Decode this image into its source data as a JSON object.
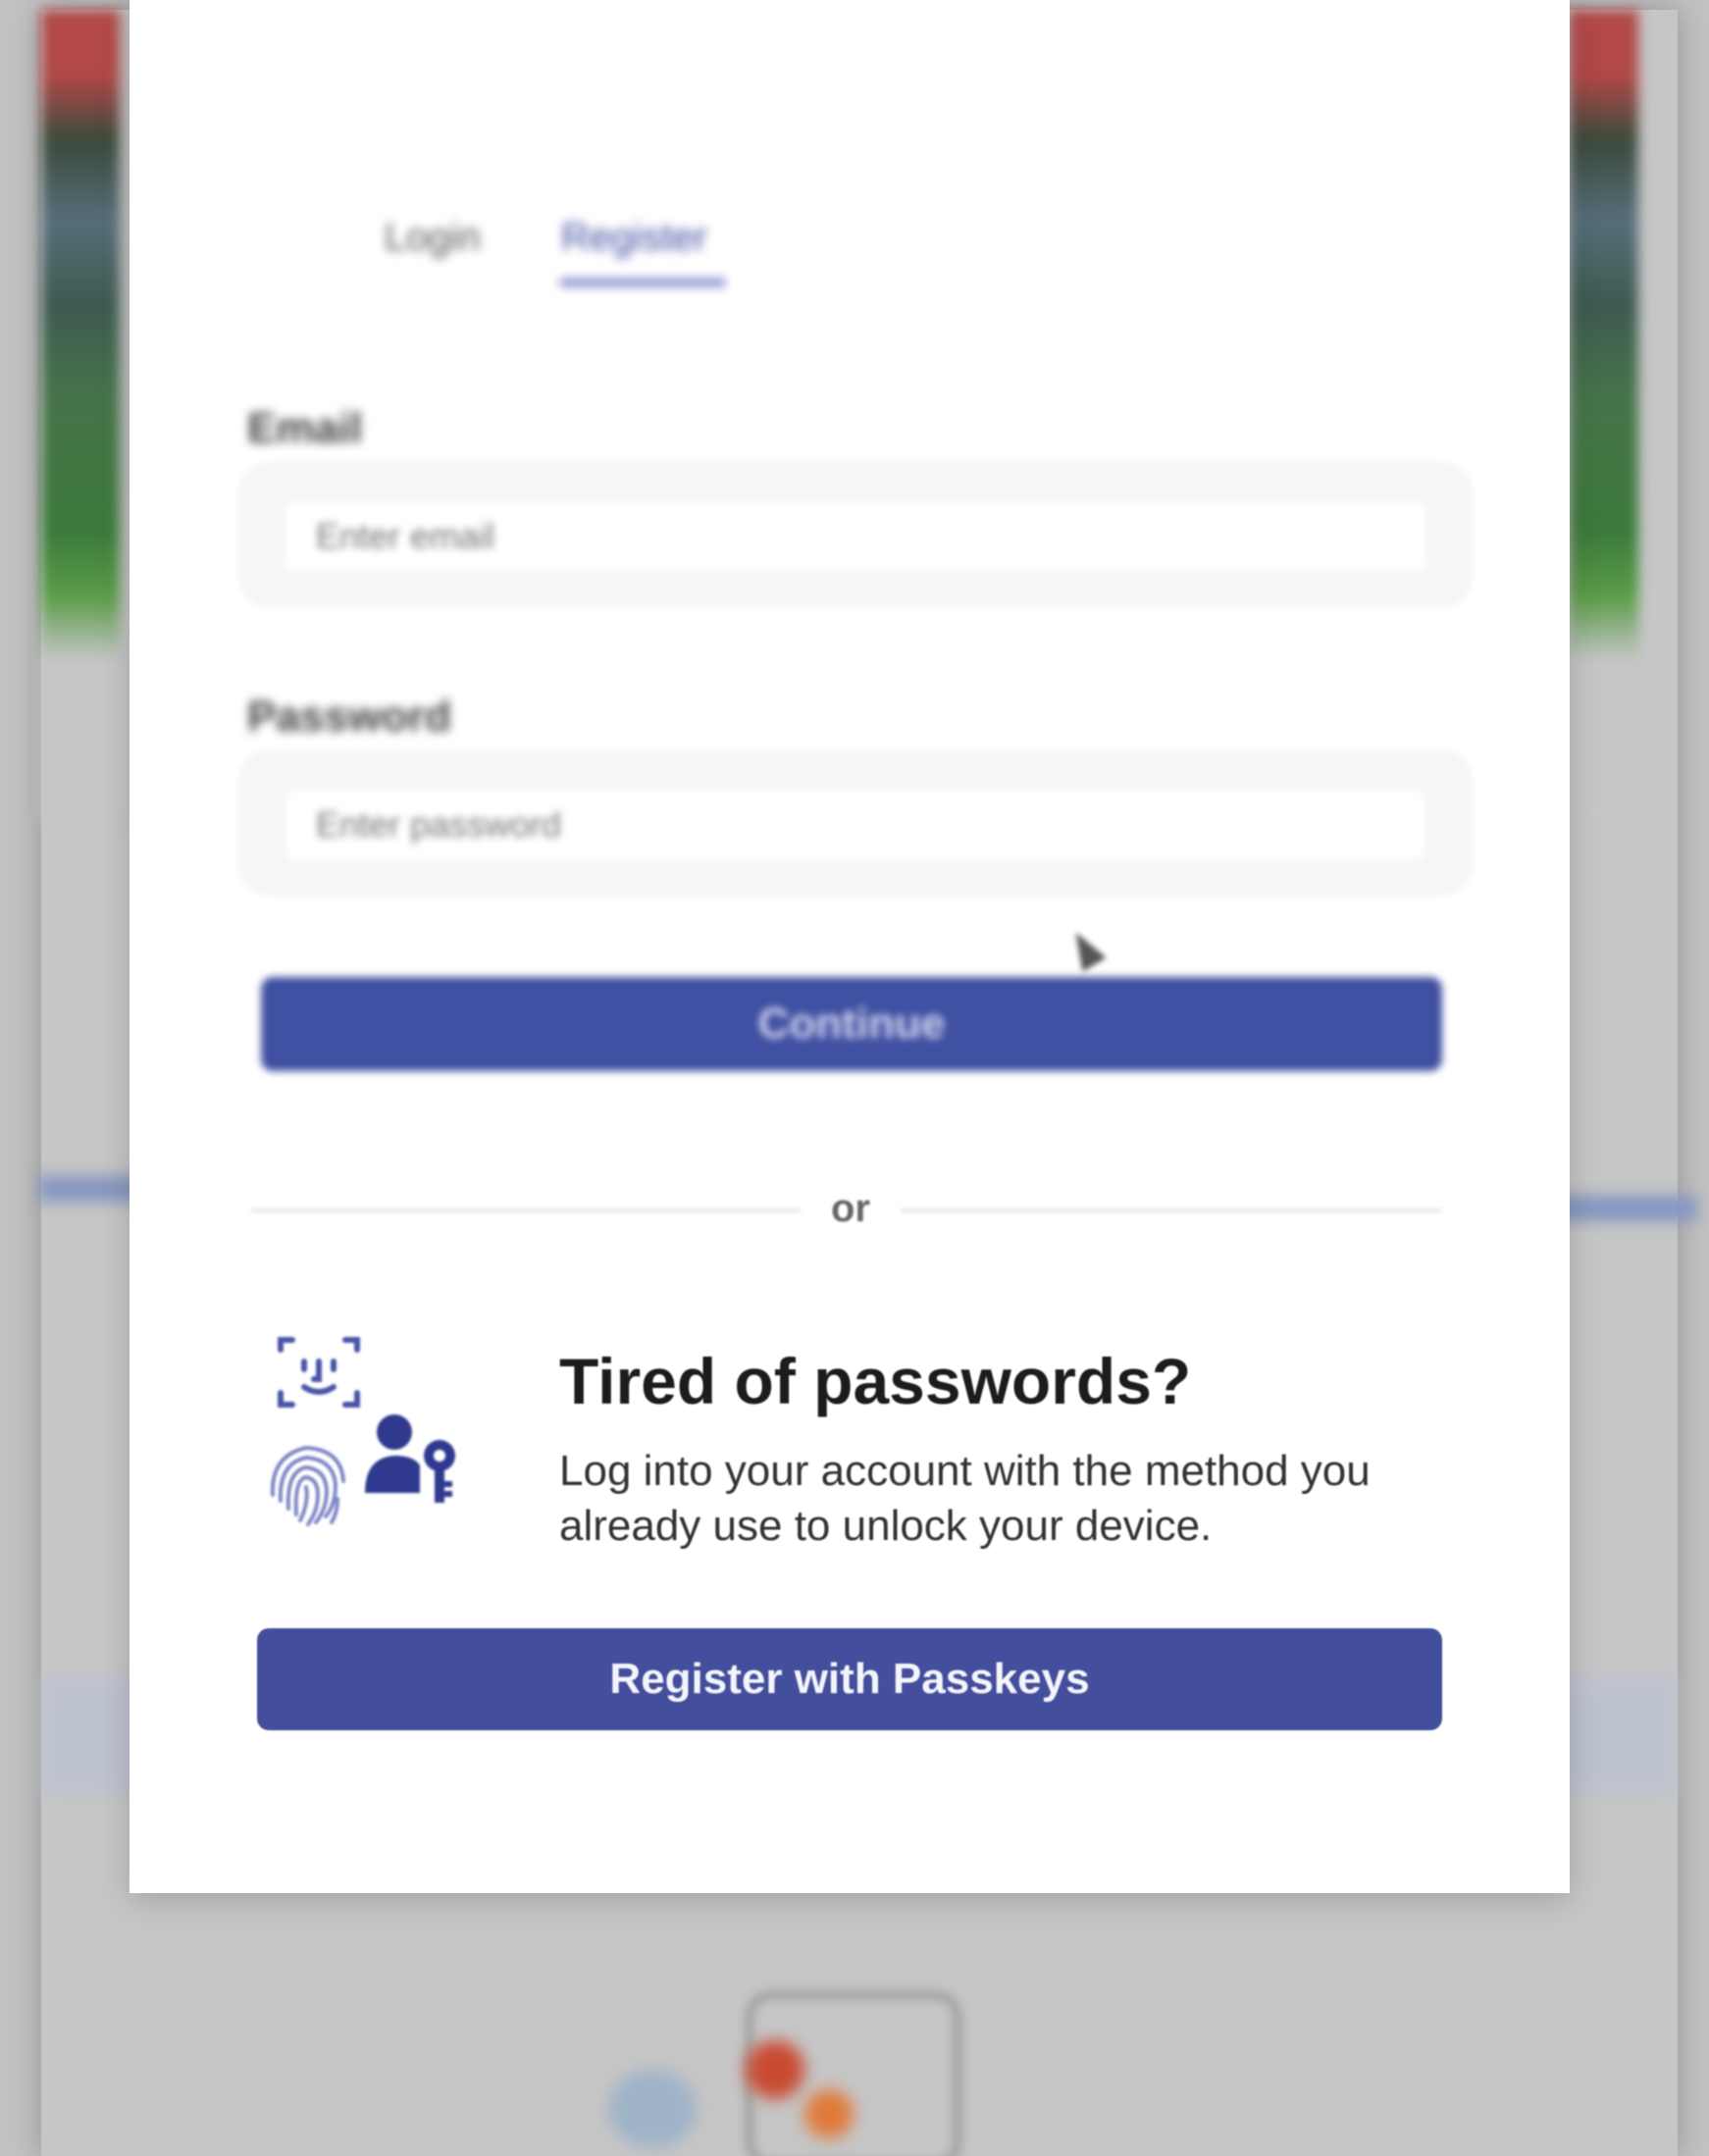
{
  "modal": {
    "top_label": "",
    "tabs": [
      {
        "label": "Login",
        "active": false
      },
      {
        "label": "Register",
        "active": true
      }
    ],
    "email": {
      "label": "Email",
      "placeholder": "Enter email"
    },
    "password": {
      "label": "Password",
      "placeholder": "Enter password"
    },
    "continue_label": "Continue",
    "divider_text": "or",
    "promo": {
      "title": "Tired of passwords?",
      "body": "Log into your account with the method you already use to unlock your device.",
      "icons": [
        "face-id-icon",
        "fingerprint-icon",
        "user-key-icon"
      ]
    },
    "passkeys_button_label": "Register with Passkeys"
  },
  "colors": {
    "primary": "#434e9c",
    "accent_tab": "#3f4ba0",
    "overlay": "#c6c6c6"
  }
}
